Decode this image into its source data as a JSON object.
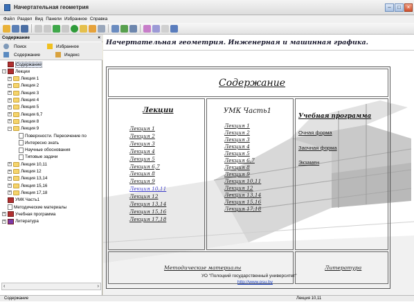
{
  "window": {
    "title": "Начертательная геометрия"
  },
  "menu": [
    "Файл",
    "Раздел",
    "Вид",
    "Панели",
    "Избранное",
    "Справка"
  ],
  "panel": {
    "title": "Содержание",
    "close": "×",
    "tabs": {
      "search": "Поиск",
      "favorites": "Избранное",
      "contents": "Содержание",
      "index": "Индекс"
    }
  },
  "tree": [
    {
      "label": "Содержание",
      "level": 0,
      "icon": "book-red",
      "expander": ""
    },
    {
      "label": "Лекции",
      "level": 0,
      "icon": "book-red",
      "expander": "−"
    },
    {
      "label": "Лекция 1",
      "level": 1,
      "icon": "folder",
      "expander": "+"
    },
    {
      "label": "Лекция 2",
      "level": 1,
      "icon": "folder",
      "expander": "+"
    },
    {
      "label": "Лекция 3",
      "level": 1,
      "icon": "folder",
      "expander": "+"
    },
    {
      "label": "Лекция 4",
      "level": 1,
      "icon": "folder",
      "expander": "+"
    },
    {
      "label": "Лекция 5",
      "level": 1,
      "icon": "folder",
      "expander": "+"
    },
    {
      "label": "Лекция 6,7",
      "level": 1,
      "icon": "folder",
      "expander": "+"
    },
    {
      "label": "Лекция 8",
      "level": 1,
      "icon": "folder",
      "expander": "+"
    },
    {
      "label": "Лекция 9",
      "level": 1,
      "icon": "folder",
      "expander": "−"
    },
    {
      "label": "Поверхности. Пересечение по",
      "level": 2,
      "icon": "doc",
      "expander": ""
    },
    {
      "label": "Интересно знать",
      "level": 2,
      "icon": "doc",
      "expander": ""
    },
    {
      "label": "Научные обоснования",
      "level": 2,
      "icon": "doc",
      "expander": ""
    },
    {
      "label": "Типовые задачи",
      "level": 2,
      "icon": "doc",
      "expander": ""
    },
    {
      "label": "Лекция 10,11",
      "level": 1,
      "icon": "folder",
      "expander": "+"
    },
    {
      "label": "Лекция 12",
      "level": 1,
      "icon": "folder",
      "expander": "+"
    },
    {
      "label": "Лекция 13,14",
      "level": 1,
      "icon": "folder",
      "expander": "+"
    },
    {
      "label": "Лекция 15,16",
      "level": 1,
      "icon": "folder",
      "expander": "+"
    },
    {
      "label": "Лекция 17,18",
      "level": 1,
      "icon": "folder",
      "expander": "+"
    },
    {
      "label": "УМК Часть1",
      "level": 0,
      "icon": "book-red",
      "expander": ""
    },
    {
      "label": "Методические материалы",
      "level": 0,
      "icon": "doc",
      "expander": ""
    },
    {
      "label": "Учебная программа",
      "level": 0,
      "icon": "book-red",
      "expander": "+"
    },
    {
      "label": "Литература",
      "level": 0,
      "icon": "book-purple",
      "expander": "+"
    }
  ],
  "page": {
    "title": "Начертательная геометрия. Инженерная и машинная графика.",
    "contents_heading": "Содержание",
    "lectures": {
      "heading": "Лекции",
      "items": [
        "Лекция 1",
        "Лекция 2",
        "Лекция 3",
        "Лекция 4",
        "Лекция 5",
        "Лекция 6,7",
        "Лекция 8",
        "Лекция 9",
        "Лекция 10,11",
        "Лекция 12",
        "Лекция 13,14",
        "Лекция 15,16",
        "Лекция 17,18"
      ],
      "visited_index": 8
    },
    "umk": {
      "heading": "УМК Часть1",
      "items": [
        "Лекция 1",
        "Лекция 2",
        "Лекция 3",
        "Лекция 4",
        "Лекция 5",
        "Лекция 6,7",
        "Лекция 8",
        "Лекция 9",
        "Лекция 10,11",
        "Лекция 12",
        "Лекция 13,14",
        "Лекция 15,16",
        "Лекция 17,18"
      ]
    },
    "program": {
      "heading": "Учебная программа",
      "items": [
        "Очная форма",
        "Заочная форма",
        "Экзамен"
      ]
    },
    "methods": "Методические материалы",
    "literature": "Литература",
    "footer_org": "УО \"Полоцкий государственный университет\"",
    "footer_url": "http://www.psu.by"
  },
  "status": {
    "left": "Содержание",
    "right": "Лекция 10,11"
  }
}
